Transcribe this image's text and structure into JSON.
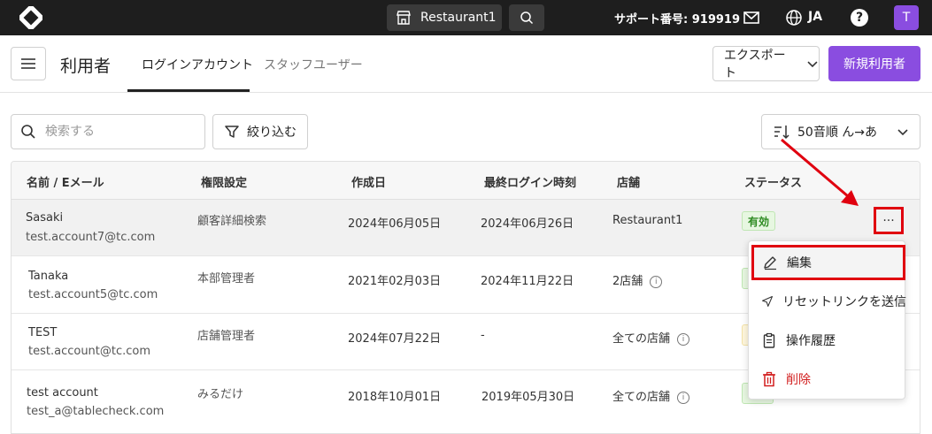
{
  "topbar": {
    "store_name": "Restaurant1",
    "support_text": "サポート番号: 919919",
    "language": "JA",
    "help_glyph": "?",
    "avatar_initial": "T"
  },
  "header": {
    "title": "利用者",
    "tabs": [
      {
        "label": "ログインアカウント",
        "active": true
      },
      {
        "label": "スタッフユーザー",
        "active": false
      }
    ],
    "export_label": "エクスポート",
    "new_user_label": "新規利用者"
  },
  "toolbar": {
    "search_placeholder": "検索する",
    "filter_label": "絞り込む",
    "sort_label": "50音順 ん→あ"
  },
  "table": {
    "columns": [
      "名前 / Eメール",
      "権限設定",
      "作成日",
      "最終ログイン時刻",
      "店舗",
      "ステータス"
    ],
    "rows": [
      {
        "name": "Sasaki",
        "email": "test.account7@tc.com",
        "role": "顧客詳細検索",
        "created": "2024年06月05日",
        "last_login": "2024年06月26日",
        "store": "Restaurant1",
        "store_info": false,
        "status": "有効"
      },
      {
        "name": "Tanaka",
        "email": "test.account5@tc.com",
        "role": "本部管理者",
        "created": "2021年02月03日",
        "last_login": "2024年11月22日",
        "store": "2店舗",
        "store_info": true,
        "status": ""
      },
      {
        "name": "TEST",
        "email": "test.account@tc.com",
        "role": "店舗管理者",
        "created": "2024年07月22日",
        "last_login": "-",
        "store": "全ての店舗",
        "store_info": true,
        "status": ""
      },
      {
        "name": "test account",
        "email": "test_a@tablecheck.com",
        "role": "みるだけ",
        "created": "2018年10月01日",
        "last_login": "2019年05月30日",
        "store": "全ての店舗",
        "store_info": true,
        "status": ""
      }
    ]
  },
  "row_menu": {
    "more_glyph": "···",
    "items": [
      {
        "label": "編集",
        "icon": "pencil-icon"
      },
      {
        "label": "リセットリンクを送信",
        "icon": "send-icon"
      },
      {
        "label": "操作履歴",
        "icon": "clipboard-icon"
      },
      {
        "label": "削除",
        "icon": "trash-icon"
      }
    ]
  },
  "colors": {
    "topbar_bg": "#1e1e1e",
    "accent": "#8a4de0",
    "annotation_red": "#e0000f",
    "danger": "#d21f1f",
    "status_green": "#2e8b22"
  }
}
